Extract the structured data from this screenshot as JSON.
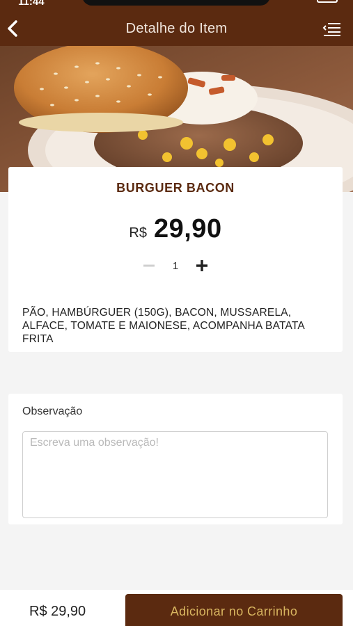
{
  "status_bar": {
    "time": "11:44"
  },
  "header": {
    "title": "Detalhe do Item",
    "back_icon": "chevron-left-icon",
    "menu_icon": "menu-list-icon"
  },
  "product": {
    "image": "burger-photo",
    "name": "BURGUER BACON",
    "currency": "R$",
    "price": "29,90",
    "quantity": "1",
    "description": "PÃO, HAMBÚRGUER (150G), BACON, MUSSARELA, ALFACE, TOMATE E MAIONESE, ACOMPANHA BATATA FRITA"
  },
  "observation": {
    "label": "Observação",
    "placeholder": "Escreva uma observação!",
    "value": ""
  },
  "footer": {
    "total": "R$ 29,90",
    "add_button": "Adicionar no Carrinho"
  },
  "colors": {
    "brand": "#5b2a10",
    "button_text": "#d9b660",
    "background": "#f4f4f4"
  }
}
